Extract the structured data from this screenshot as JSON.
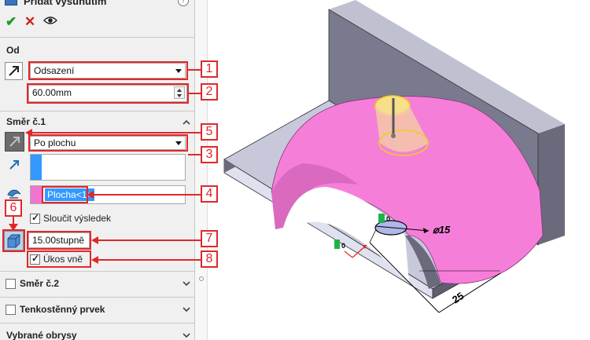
{
  "panel": {
    "title": "Přidat vysunutím",
    "help": "?",
    "from": {
      "header": "Od",
      "start_condition": "Odsazení",
      "offset_value": "60.00mm"
    },
    "direction1": {
      "header": "Směr č.1",
      "end_condition": "Po plochu",
      "face_selection": "Plocha<1>",
      "merge_label": "Sloučit výsledek",
      "merge_checked": true,
      "draft_angle": "15.00stupně",
      "draft_outward_label": "Úkos vně",
      "draft_outward_checked": true
    },
    "direction2": {
      "header": "Směr č.2",
      "checked": false
    },
    "thin_feature": {
      "header": "Tenkostěnný prvek",
      "checked": false
    },
    "selected_contours": {
      "header": "Vybrané obrysy"
    }
  },
  "callouts": [
    "1",
    "2",
    "3",
    "4",
    "5",
    "6",
    "7",
    "8"
  ],
  "viewport": {
    "diameter_label": "⌀15",
    "length_label": "25",
    "origin_label": "0",
    "triad_label": "0"
  },
  "colors": {
    "accent_red": "#e0282a",
    "selection_blue": "#3399ff",
    "face_pink": "#f57fd8",
    "body_gray": "#6e6e80",
    "triad_green": "#21b14b"
  }
}
